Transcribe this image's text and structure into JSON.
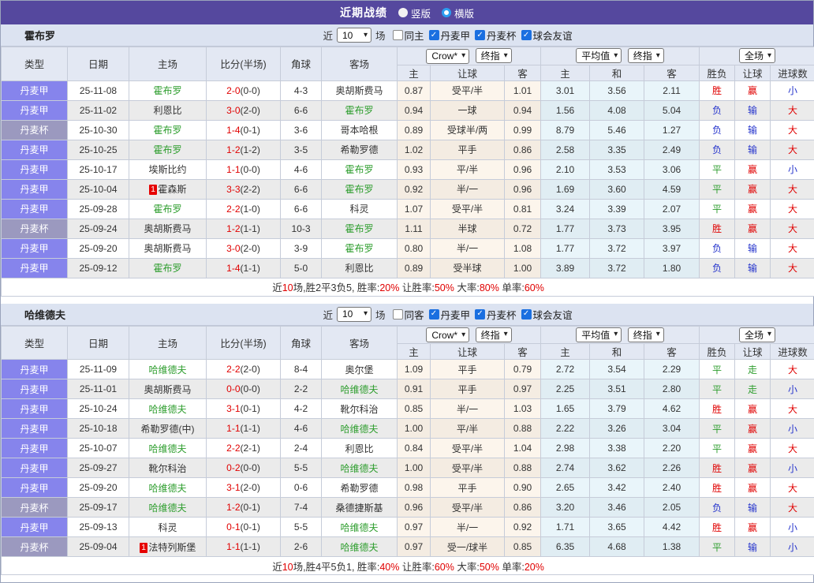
{
  "titlebar": {
    "title": "近期战绩",
    "layout_options": [
      {
        "label": "竖版",
        "selected": false
      },
      {
        "label": "横版",
        "selected": true
      }
    ]
  },
  "icons": {
    "check": "✓",
    "dropdown_arrow": "▾"
  },
  "colors": {
    "accent_purple": "#55489e",
    "league_cell": "#8684ec",
    "cup_cell": "#9b99bf",
    "win_red": "#e00000",
    "draw_green": "#2f9e2f",
    "lose_blue": "#2433cc"
  },
  "filter_labels": {
    "near": "近",
    "games": "场"
  },
  "selects": {
    "odds_company": "Crow*",
    "odds_ref": "终指",
    "avg": "平均值",
    "avg_ref": "终指",
    "scope": "全场"
  },
  "table_head": {
    "cols": [
      "类型",
      "日期",
      "主场",
      "比分(半场)",
      "角球",
      "客场"
    ],
    "odds_sub": [
      "主",
      "让球",
      "客"
    ],
    "avg_sub": [
      "主",
      "和",
      "客"
    ],
    "result_sub": [
      "胜负",
      "让球",
      "进球数"
    ]
  },
  "sections": [
    {
      "team": "霍布罗",
      "filter": {
        "rounds": "10",
        "checkboxes": [
          {
            "label": "同主",
            "checked": false
          },
          {
            "label": "丹麦甲",
            "checked": true
          },
          {
            "label": "丹麦杯",
            "checked": true
          },
          {
            "label": "球会友谊",
            "checked": true
          }
        ]
      },
      "rows": [
        {
          "league": "丹麦甲",
          "cup": false,
          "date": "25-11-08",
          "home": {
            "name": "霍布罗",
            "green": true,
            "badge": ""
          },
          "score": "2-0",
          "half": "(0-0)",
          "corners": "4-3",
          "away": {
            "name": "奥胡斯费马",
            "green": false,
            "badge": ""
          },
          "odds": [
            "0.87",
            "受平/半",
            "1.01"
          ],
          "avg": [
            "3.01",
            "3.56",
            "2.11"
          ],
          "result": [
            "胜",
            "r"
          ],
          "handicap": [
            "赢",
            "r"
          ],
          "goals": [
            "小",
            "b"
          ]
        },
        {
          "league": "丹麦甲",
          "cup": false,
          "date": "25-11-02",
          "home": {
            "name": "利恩比",
            "green": false,
            "badge": ""
          },
          "score": "3-0",
          "half": "(2-0)",
          "corners": "6-6",
          "away": {
            "name": "霍布罗",
            "green": true,
            "badge": ""
          },
          "odds": [
            "0.94",
            "一球",
            "0.94"
          ],
          "avg": [
            "1.56",
            "4.08",
            "5.04"
          ],
          "result": [
            "负",
            "b"
          ],
          "handicap": [
            "输",
            "b"
          ],
          "goals": [
            "大",
            "r"
          ]
        },
        {
          "league": "丹麦杯",
          "cup": true,
          "date": "25-10-30",
          "home": {
            "name": "霍布罗",
            "green": true,
            "badge": ""
          },
          "score": "1-4",
          "half": "(0-1)",
          "corners": "3-6",
          "away": {
            "name": "哥本哈根",
            "green": false,
            "badge": ""
          },
          "odds": [
            "0.89",
            "受球半/两",
            "0.99"
          ],
          "avg": [
            "8.79",
            "5.46",
            "1.27"
          ],
          "result": [
            "负",
            "b"
          ],
          "handicap": [
            "输",
            "b"
          ],
          "goals": [
            "大",
            "r"
          ]
        },
        {
          "league": "丹麦甲",
          "cup": false,
          "date": "25-10-25",
          "home": {
            "name": "霍布罗",
            "green": true,
            "badge": ""
          },
          "score": "1-2",
          "half": "(1-2)",
          "corners": "3-5",
          "away": {
            "name": "希勒罗德",
            "green": false,
            "badge": ""
          },
          "odds": [
            "1.02",
            "平手",
            "0.86"
          ],
          "avg": [
            "2.58",
            "3.35",
            "2.49"
          ],
          "result": [
            "负",
            "b"
          ],
          "handicap": [
            "输",
            "b"
          ],
          "goals": [
            "大",
            "r"
          ]
        },
        {
          "league": "丹麦甲",
          "cup": false,
          "date": "25-10-17",
          "home": {
            "name": "埃斯比约",
            "green": false,
            "badge": ""
          },
          "score": "1-1",
          "half": "(0-0)",
          "corners": "4-6",
          "away": {
            "name": "霍布罗",
            "green": true,
            "badge": ""
          },
          "odds": [
            "0.93",
            "平/半",
            "0.96"
          ],
          "avg": [
            "2.10",
            "3.53",
            "3.06"
          ],
          "result": [
            "平",
            "g"
          ],
          "handicap": [
            "赢",
            "r"
          ],
          "goals": [
            "小",
            "b"
          ]
        },
        {
          "league": "丹麦甲",
          "cup": false,
          "date": "25-10-04",
          "home": {
            "name": "霍森斯",
            "green": false,
            "badge": "1"
          },
          "score": "3-3",
          "half": "(2-2)",
          "corners": "6-6",
          "away": {
            "name": "霍布罗",
            "green": true,
            "badge": ""
          },
          "odds": [
            "0.92",
            "半/一",
            "0.96"
          ],
          "avg": [
            "1.69",
            "3.60",
            "4.59"
          ],
          "result": [
            "平",
            "g"
          ],
          "handicap": [
            "赢",
            "r"
          ],
          "goals": [
            "大",
            "r"
          ]
        },
        {
          "league": "丹麦甲",
          "cup": false,
          "date": "25-09-28",
          "home": {
            "name": "霍布罗",
            "green": true,
            "badge": ""
          },
          "score": "2-2",
          "half": "(1-0)",
          "corners": "6-6",
          "away": {
            "name": "科灵",
            "green": false,
            "badge": ""
          },
          "odds": [
            "1.07",
            "受平/半",
            "0.81"
          ],
          "avg": [
            "3.24",
            "3.39",
            "2.07"
          ],
          "result": [
            "平",
            "g"
          ],
          "handicap": [
            "赢",
            "r"
          ],
          "goals": [
            "大",
            "r"
          ]
        },
        {
          "league": "丹麦杯",
          "cup": true,
          "date": "25-09-24",
          "home": {
            "name": "奥胡斯费马",
            "green": false,
            "badge": ""
          },
          "score": "1-2",
          "half": "(1-1)",
          "corners": "10-3",
          "away": {
            "name": "霍布罗",
            "green": true,
            "badge": ""
          },
          "odds": [
            "1.11",
            "半球",
            "0.72"
          ],
          "avg": [
            "1.77",
            "3.73",
            "3.95"
          ],
          "result": [
            "胜",
            "r"
          ],
          "handicap": [
            "赢",
            "r"
          ],
          "goals": [
            "大",
            "r"
          ]
        },
        {
          "league": "丹麦甲",
          "cup": false,
          "date": "25-09-20",
          "home": {
            "name": "奥胡斯费马",
            "green": false,
            "badge": ""
          },
          "score": "3-0",
          "half": "(2-0)",
          "corners": "3-9",
          "away": {
            "name": "霍布罗",
            "green": true,
            "badge": ""
          },
          "odds": [
            "0.80",
            "半/一",
            "1.08"
          ],
          "avg": [
            "1.77",
            "3.72",
            "3.97"
          ],
          "result": [
            "负",
            "b"
          ],
          "handicap": [
            "输",
            "b"
          ],
          "goals": [
            "大",
            "r"
          ]
        },
        {
          "league": "丹麦甲",
          "cup": false,
          "date": "25-09-12",
          "home": {
            "name": "霍布罗",
            "green": true,
            "badge": ""
          },
          "score": "1-4",
          "half": "(1-1)",
          "corners": "5-0",
          "away": {
            "name": "利恩比",
            "green": false,
            "badge": ""
          },
          "odds": [
            "0.89",
            "受半球",
            "1.00"
          ],
          "avg": [
            "3.89",
            "3.72",
            "1.80"
          ],
          "result": [
            "负",
            "b"
          ],
          "handicap": [
            "输",
            "b"
          ],
          "goals": [
            "大",
            "r"
          ]
        }
      ],
      "summary": [
        {
          "t": "近"
        },
        {
          "t": "10",
          "red": true
        },
        {
          "t": "场,胜2平3负5, 胜率:"
        },
        {
          "t": "20%",
          "red": true
        },
        {
          "t": " 让胜率:"
        },
        {
          "t": "50%",
          "red": true
        },
        {
          "t": " 大率:"
        },
        {
          "t": "80%",
          "red": true
        },
        {
          "t": " 单率:"
        },
        {
          "t": "60%",
          "red": true
        }
      ]
    },
    {
      "team": "哈维德夫",
      "filter": {
        "rounds": "10",
        "checkboxes": [
          {
            "label": "同客",
            "checked": false
          },
          {
            "label": "丹麦甲",
            "checked": true
          },
          {
            "label": "丹麦杯",
            "checked": true
          },
          {
            "label": "球会友谊",
            "checked": true
          }
        ]
      },
      "rows": [
        {
          "league": "丹麦甲",
          "cup": false,
          "date": "25-11-09",
          "home": {
            "name": "哈维德夫",
            "green": true,
            "badge": ""
          },
          "score": "2-2",
          "half": "(2-0)",
          "corners": "8-4",
          "away": {
            "name": "奥尔堡",
            "green": false,
            "badge": ""
          },
          "odds": [
            "1.09",
            "平手",
            "0.79"
          ],
          "avg": [
            "2.72",
            "3.54",
            "2.29"
          ],
          "result": [
            "平",
            "g"
          ],
          "handicap": [
            "走",
            "g"
          ],
          "goals": [
            "大",
            "r"
          ]
        },
        {
          "league": "丹麦甲",
          "cup": false,
          "date": "25-11-01",
          "home": {
            "name": "奥胡斯费马",
            "green": false,
            "badge": ""
          },
          "score": "0-0",
          "half": "(0-0)",
          "corners": "2-2",
          "away": {
            "name": "哈维德夫",
            "green": true,
            "badge": ""
          },
          "odds": [
            "0.91",
            "平手",
            "0.97"
          ],
          "avg": [
            "2.25",
            "3.51",
            "2.80"
          ],
          "result": [
            "平",
            "g"
          ],
          "handicap": [
            "走",
            "g"
          ],
          "goals": [
            "小",
            "b"
          ]
        },
        {
          "league": "丹麦甲",
          "cup": false,
          "date": "25-10-24",
          "home": {
            "name": "哈维德夫",
            "green": true,
            "badge": ""
          },
          "score": "3-1",
          "half": "(0-1)",
          "corners": "4-2",
          "away": {
            "name": "靴尔科治",
            "green": false,
            "badge": ""
          },
          "odds": [
            "0.85",
            "半/一",
            "1.03"
          ],
          "avg": [
            "1.65",
            "3.79",
            "4.62"
          ],
          "result": [
            "胜",
            "r"
          ],
          "handicap": [
            "赢",
            "r"
          ],
          "goals": [
            "大",
            "r"
          ]
        },
        {
          "league": "丹麦甲",
          "cup": false,
          "date": "25-10-18",
          "home": {
            "name": "希勒罗德(中)",
            "green": false,
            "badge": ""
          },
          "score": "1-1",
          "half": "(1-1)",
          "corners": "4-6",
          "away": {
            "name": "哈维德夫",
            "green": true,
            "badge": ""
          },
          "odds": [
            "1.00",
            "平/半",
            "0.88"
          ],
          "avg": [
            "2.22",
            "3.26",
            "3.04"
          ],
          "result": [
            "平",
            "g"
          ],
          "handicap": [
            "赢",
            "r"
          ],
          "goals": [
            "小",
            "b"
          ]
        },
        {
          "league": "丹麦甲",
          "cup": false,
          "date": "25-10-07",
          "home": {
            "name": "哈维德夫",
            "green": true,
            "badge": ""
          },
          "score": "2-2",
          "half": "(2-1)",
          "corners": "2-4",
          "away": {
            "name": "利恩比",
            "green": false,
            "badge": ""
          },
          "odds": [
            "0.84",
            "受平/半",
            "1.04"
          ],
          "avg": [
            "2.98",
            "3.38",
            "2.20"
          ],
          "result": [
            "平",
            "g"
          ],
          "handicap": [
            "赢",
            "r"
          ],
          "goals": [
            "大",
            "r"
          ]
        },
        {
          "league": "丹麦甲",
          "cup": false,
          "date": "25-09-27",
          "home": {
            "name": "靴尔科治",
            "green": false,
            "badge": ""
          },
          "score": "0-2",
          "half": "(0-0)",
          "corners": "5-5",
          "away": {
            "name": "哈维德夫",
            "green": true,
            "badge": ""
          },
          "odds": [
            "1.00",
            "受平/半",
            "0.88"
          ],
          "avg": [
            "2.74",
            "3.62",
            "2.26"
          ],
          "result": [
            "胜",
            "r"
          ],
          "handicap": [
            "赢",
            "r"
          ],
          "goals": [
            "小",
            "b"
          ]
        },
        {
          "league": "丹麦甲",
          "cup": false,
          "date": "25-09-20",
          "home": {
            "name": "哈维德夫",
            "green": true,
            "badge": ""
          },
          "score": "3-1",
          "half": "(2-0)",
          "corners": "0-6",
          "away": {
            "name": "希勒罗德",
            "green": false,
            "badge": ""
          },
          "odds": [
            "0.98",
            "平手",
            "0.90"
          ],
          "avg": [
            "2.65",
            "3.42",
            "2.40"
          ],
          "result": [
            "胜",
            "r"
          ],
          "handicap": [
            "赢",
            "r"
          ],
          "goals": [
            "大",
            "r"
          ]
        },
        {
          "league": "丹麦杯",
          "cup": true,
          "date": "25-09-17",
          "home": {
            "name": "哈维德夫",
            "green": true,
            "badge": ""
          },
          "score": "1-2",
          "half": "(0-1)",
          "corners": "7-4",
          "away": {
            "name": "桑德捷斯基",
            "green": false,
            "badge": ""
          },
          "odds": [
            "0.96",
            "受平/半",
            "0.86"
          ],
          "avg": [
            "3.20",
            "3.46",
            "2.05"
          ],
          "result": [
            "负",
            "b"
          ],
          "handicap": [
            "输",
            "b"
          ],
          "goals": [
            "大",
            "r"
          ]
        },
        {
          "league": "丹麦甲",
          "cup": false,
          "date": "25-09-13",
          "home": {
            "name": "科灵",
            "green": false,
            "badge": ""
          },
          "score": "0-1",
          "half": "(0-1)",
          "corners": "5-5",
          "away": {
            "name": "哈维德夫",
            "green": true,
            "badge": ""
          },
          "odds": [
            "0.97",
            "半/一",
            "0.92"
          ],
          "avg": [
            "1.71",
            "3.65",
            "4.42"
          ],
          "result": [
            "胜",
            "r"
          ],
          "handicap": [
            "赢",
            "r"
          ],
          "goals": [
            "小",
            "b"
          ]
        },
        {
          "league": "丹麦杯",
          "cup": true,
          "date": "25-09-04",
          "home": {
            "name": "法特列斯堡",
            "green": false,
            "badge": "1"
          },
          "score": "1-1",
          "half": "(1-1)",
          "corners": "2-6",
          "away": {
            "name": "哈维德夫",
            "green": true,
            "badge": ""
          },
          "odds": [
            "0.97",
            "受一/球半",
            "0.85"
          ],
          "avg": [
            "6.35",
            "4.68",
            "1.38"
          ],
          "result": [
            "平",
            "g"
          ],
          "handicap": [
            "输",
            "b"
          ],
          "goals": [
            "小",
            "b"
          ]
        }
      ],
      "summary": [
        {
          "t": "近"
        },
        {
          "t": "10",
          "red": true
        },
        {
          "t": "场,胜4平5负1, 胜率:"
        },
        {
          "t": "40%",
          "red": true
        },
        {
          "t": " 让胜率:"
        },
        {
          "t": "60%",
          "red": true
        },
        {
          "t": " 大率:"
        },
        {
          "t": "50%",
          "red": true
        },
        {
          "t": " 单率:"
        },
        {
          "t": "20%",
          "red": true
        }
      ]
    }
  ]
}
